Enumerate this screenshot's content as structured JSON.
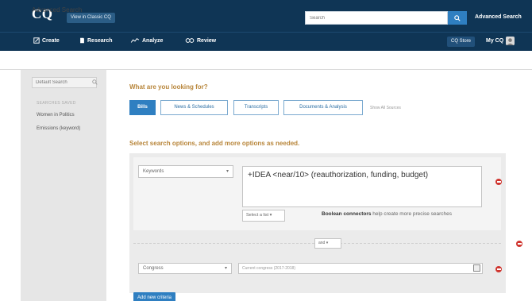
{
  "header": {
    "logo": "CQ",
    "classic_label": "View in Classic CQ",
    "search_placeholder": "Search",
    "advanced_search_label": "Advanced Search"
  },
  "nav": {
    "items": [
      {
        "label": "Create",
        "icon": "create-icon"
      },
      {
        "label": "Research",
        "icon": "research-icon"
      },
      {
        "label": "Analyze",
        "icon": "analyze-icon"
      },
      {
        "label": "Review",
        "icon": "review-icon"
      }
    ],
    "cq_store": "CQ Store",
    "my_cq": "My CQ"
  },
  "page": {
    "title": "Advanced Search"
  },
  "sidebar": {
    "search_placeholder": "Default Search",
    "heading": "SEARCHES SAVED",
    "items": [
      "Women in Politics",
      "Emissions (keyword)"
    ]
  },
  "main": {
    "question": "What are you looking for?",
    "tabs": [
      "Bills",
      "News & Schedules",
      "Transcripts",
      "Documents & Analysis"
    ],
    "active_tab": "Bills",
    "show_all": "Show All Sources",
    "select_options": "Select search options, and add more options as needed.",
    "criteria": {
      "field": "Keywords",
      "query": "+IDEA <near/10> (reauthorization, funding, budget)",
      "select_list": "Select a list",
      "boolean_link": "Boolean connectors",
      "boolean_rest": " help create more precise searches",
      "connector": "and",
      "second_field": "Congress",
      "congress_value": "Current congress (2017-2018)",
      "add_criteria": "Add new criteria"
    }
  },
  "colors": {
    "navy": "#0f3555",
    "accent_blue": "#2f7fc1",
    "gold": "#b8863b",
    "remove_red": "#d0352f"
  }
}
